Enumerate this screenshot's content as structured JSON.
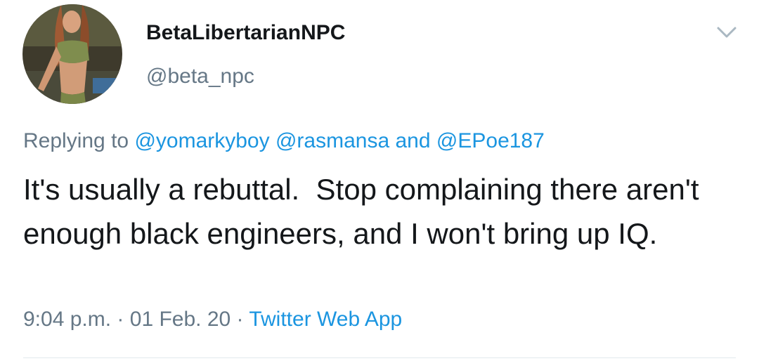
{
  "tweet": {
    "author": {
      "display_name": "BetaLibertarianNPC",
      "handle": "@beta_npc",
      "avatar_icon": "profile-photo"
    },
    "menu_icon": "chevron-down-icon",
    "reply": {
      "prefix": "Replying to",
      "mentions": [
        "@yomarkyboy",
        "@rasmansa",
        "@EPoe187"
      ],
      "conjunction": "and"
    },
    "text": "It's usually a rebuttal.  Stop complaining there aren't enough black engineers, and I won't bring up IQ.",
    "time": "9:04 p.m.",
    "date": "01 Feb. 20",
    "separator": "·",
    "source": "Twitter Web App"
  },
  "colors": {
    "text": "#14171a",
    "muted": "#657786",
    "link": "#1b95e0",
    "divider": "#e1e8ed"
  }
}
